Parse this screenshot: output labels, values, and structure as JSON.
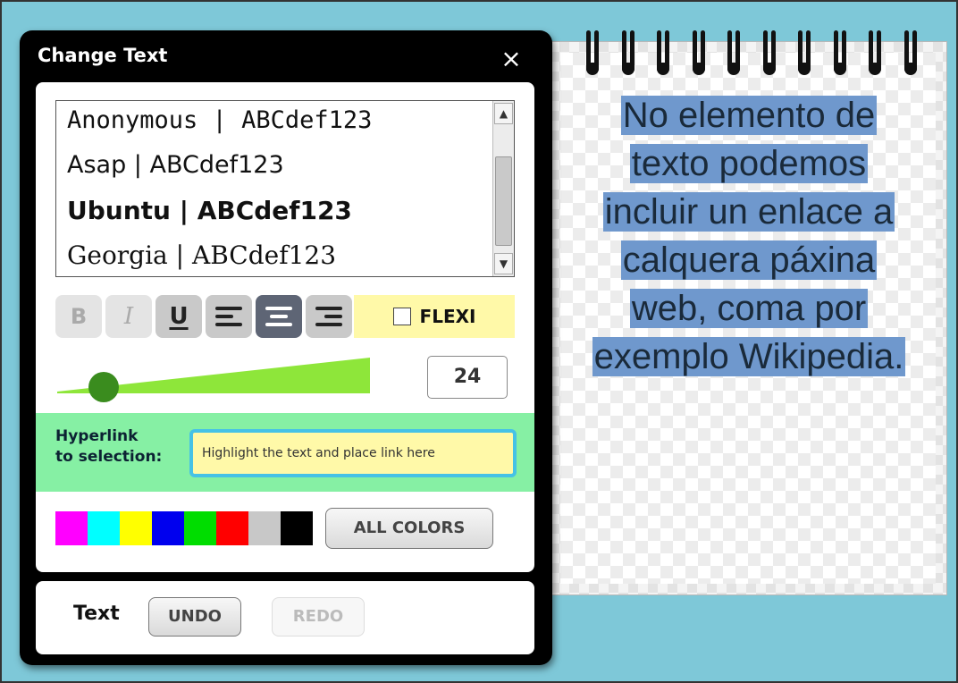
{
  "dialog": {
    "title": "Change Text",
    "close_symbol": "×"
  },
  "font_list": {
    "items": [
      "Anonymous  |  ABCdef123",
      "Asap | ABCdef123",
      "Ubuntu | ABCdef123",
      "Georgia | ABCdef123"
    ],
    "scroll_up_symbol": "▲",
    "scroll_down_symbol": "▼"
  },
  "format": {
    "bold_label": "B",
    "italic_label": "I",
    "underline_label": "U",
    "align_left_icon": "align-left-icon",
    "align_center_icon": "align-center-icon",
    "align_right_icon": "align-right-icon",
    "active_alignment": "center",
    "flexi_label": "FLEXI",
    "flexi_checked": false
  },
  "size": {
    "value": "24",
    "slider_fraction": 0.12
  },
  "hyperlink": {
    "label_line1": "Hyperlink",
    "label_line2": "to selection:",
    "placeholder": "Highlight the text and place link here"
  },
  "colors": {
    "swatches": [
      "#ff00ff",
      "#00ffff",
      "#ffff00",
      "#0000ee",
      "#00dd00",
      "#ff0000",
      "#c8c8c8",
      "#000000"
    ],
    "all_colors_label": "ALL COLORS",
    "slider_green": "#8ee63a",
    "link_bg": "#86f0a4",
    "highlight": "#6f98cd"
  },
  "footer": {
    "label": "Text",
    "undo_label": "UNDO",
    "redo_label": "REDO"
  },
  "note": {
    "lines": [
      "No elemento de",
      "texto podemos",
      "incluir un enlace a",
      "calquera páxina",
      "web, coma por",
      "exemplo Wikipedia."
    ]
  }
}
